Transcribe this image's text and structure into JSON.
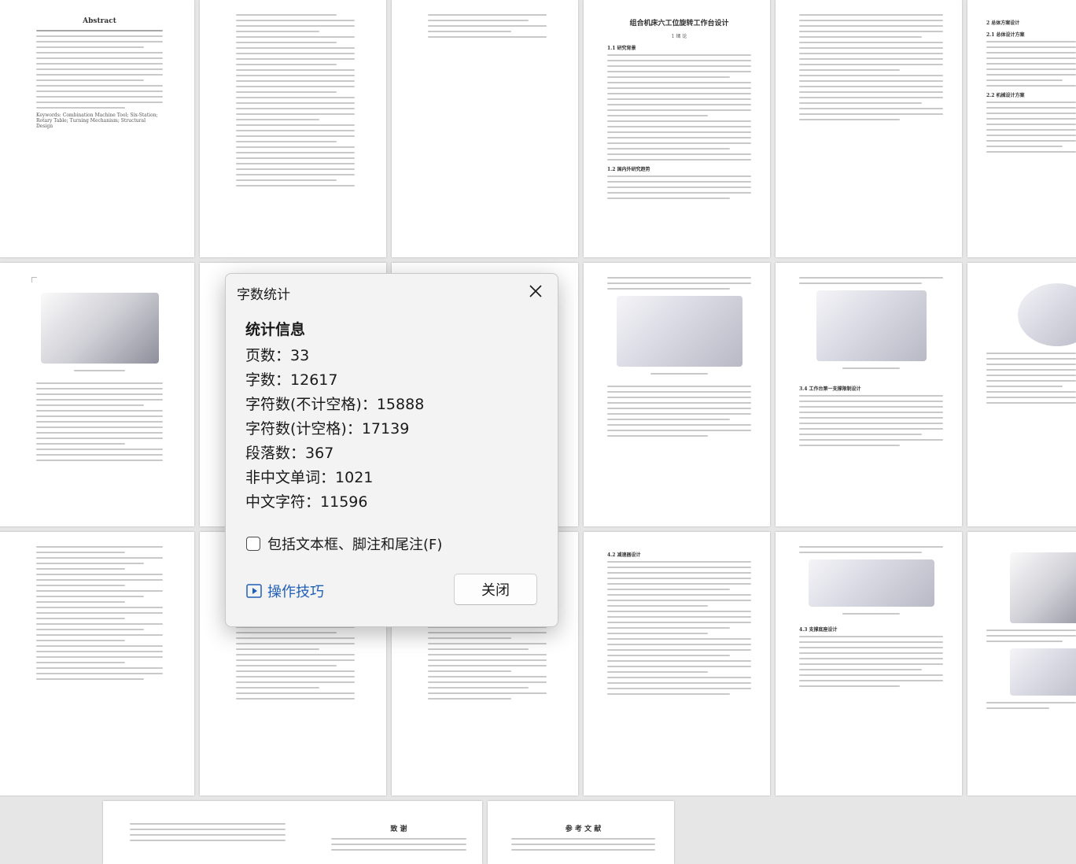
{
  "dialog": {
    "title": "字数统计",
    "section": "统计信息",
    "stats": [
      {
        "label": "页数",
        "value": "33"
      },
      {
        "label": "字数",
        "value": "12617"
      },
      {
        "label": "字符数(不计空格)",
        "value": "15888"
      },
      {
        "label": "字符数(计空格)",
        "value": "17139"
      },
      {
        "label": "段落数",
        "value": "367"
      },
      {
        "label": "非中文单词",
        "value": "1021"
      },
      {
        "label": "中文字符",
        "value": "11596"
      }
    ],
    "include_label": "包括文本框、脚注和尾注(F)",
    "include_checked": false,
    "tips_label": "操作技巧",
    "close_label": "关闭",
    "accent_color": "#1f5fb8"
  },
  "pages": {
    "abstract_title": "Abstract",
    "abstract_keywords": "Keywords: Combination Machine Tool; Six-Station; Rotary Table; Turning Mechanism; Structural Design",
    "main_title": "组合机床六工位旋转工作台设计",
    "chapter1": "1  绪  论",
    "section_1_1": "1.1 研究背景",
    "section_1_2": "1.2 国内外研究趋势",
    "chapter2": "2  总体方案设计",
    "section_2_1": "2.1 总体设计方案",
    "section_2_2": "2.2 机械设计方案",
    "section_3_4": "3.4 工作台第一支撑限制设计",
    "section_4_2": "4.2 减速器设计",
    "section_4_3": "4.3 支撑底座设计",
    "ack_title": "致  谢",
    "ref_title": "参 考 文 献"
  }
}
